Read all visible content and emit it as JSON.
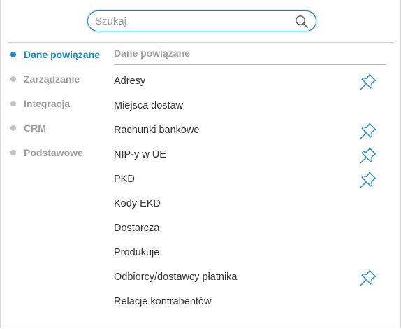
{
  "search": {
    "placeholder": "Szukaj",
    "value": ""
  },
  "nav": {
    "items": [
      {
        "label": "Dane powiązane",
        "active": true
      },
      {
        "label": "Zarządzanie",
        "active": false
      },
      {
        "label": "Integracja",
        "active": false
      },
      {
        "label": "CRM",
        "active": false
      },
      {
        "label": "Podstawowe",
        "active": false
      }
    ]
  },
  "section": {
    "title": "Dane powiązane",
    "items": [
      {
        "label": "Adresy",
        "pinned": true
      },
      {
        "label": "Miejsca dostaw",
        "pinned": false
      },
      {
        "label": "Rachunki bankowe",
        "pinned": true
      },
      {
        "label": "NIP-y w UE",
        "pinned": true
      },
      {
        "label": "PKD",
        "pinned": true
      },
      {
        "label": "Kody EKD",
        "pinned": false
      },
      {
        "label": "Dostarcza",
        "pinned": false
      },
      {
        "label": "Produkuje",
        "pinned": false
      },
      {
        "label": "Odbiorcy/dostawcy płatnika",
        "pinned": true
      },
      {
        "label": "Relacje kontrahentów",
        "pinned": false
      }
    ]
  },
  "icons": {
    "search": "search-icon",
    "pin": "pin-icon"
  },
  "colors": {
    "accent": "#1b8ccc",
    "muted": "#9d9d9d",
    "text": "#333333",
    "pin": "#2f8fd0"
  }
}
